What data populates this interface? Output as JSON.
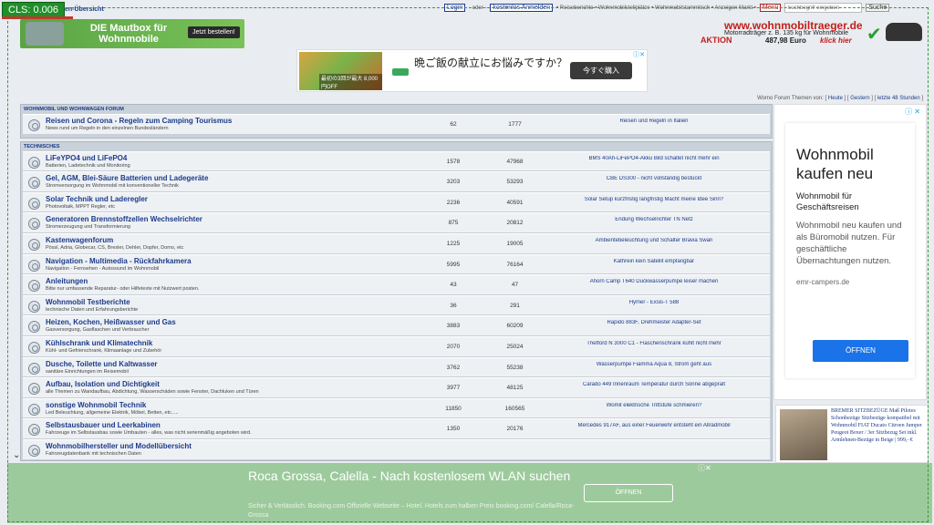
{
  "overlay": {
    "cls_label": "CLS: 0.006"
  },
  "topbar": {
    "forum_overview": "oren-Übersicht",
    "login": "Login",
    "oder": "- oder -",
    "register": "kostenlos Anmelden",
    "nav_links": "• Reiseberichte • Wohnmobilstellplätze • Wohnmobilstammtisch • Anzeigen Markt •",
    "menu": "Menü",
    "search_placeholder": "Suchbegriff eingeben",
    "search_button": "Suche"
  },
  "banner_left": {
    "title": "DIE Mautbox für Wohnmobile",
    "cta": "Jetzt bestellen!"
  },
  "banner_right": {
    "url": "www.wohnmobiltraeger.de",
    "sub": "Motorradträger z. B. 135 kg für Wohnmobile",
    "aktion": "AKTION",
    "price": "487,98 Euro",
    "klick": "klick hier"
  },
  "ad_center": {
    "headline": "晩ご飯の献立にお悩みですか？",
    "button": "今すぐ購入",
    "food_text": "最初の3回が最大 8,000円OFF"
  },
  "themes_line": {
    "prefix": "Womo Forum Themen von:",
    "heute": "Heute",
    "gestern": "Gestern",
    "letzte": "letzte 48 Stunden"
  },
  "sections": [
    {
      "title": "WOHNMOBIL UND WOHNWAGEN FORUM",
      "rows": [
        {
          "title": "Reisen und Corona - Regeln zum Camping Tourismus",
          "desc": "News rund um Regeln in den einzelnen Bundesländern",
          "topics": "62",
          "posts": "1777",
          "last": "Reisen und Regeln in Italien"
        }
      ]
    },
    {
      "title": "TECHNISCHES",
      "rows": [
        {
          "title": "LiFeYPO4 und LiFePO4",
          "desc": "Batterien, Ladetechnik und Monitoring",
          "topics": "1578",
          "posts": "47968",
          "last": "BMS 40Ah-LiFePO4-Akku Bild schaltet nicht mehr ein"
        },
        {
          "title": "Gel, AGM, Blei-Säure Batterien und Ladegeräte",
          "desc": "Stromversorgung im Wohnmobil mit konventioneller Technik",
          "topics": "3203",
          "posts": "53293",
          "last": "CBE DS300 - nicht vollständig bestückt"
        },
        {
          "title": "Solar Technik und Laderegler",
          "desc": "Photovoltaik, MPPT Regler, etc",
          "topics": "2236",
          "posts": "40591",
          "last": "Solar Setup kurzfristig langfristig Macht meine Idee Sinn?"
        },
        {
          "title": "Generatoren Brennstoffzellen Wechselrichter",
          "desc": "Stromerzeugung und Transformierung",
          "topics": "875",
          "posts": "20812",
          "last": "Endung Wechselrichter TN Netz"
        },
        {
          "title": "Kastenwagenforum",
          "desc": "Pössl, Adria, Globecar, CS, Bresler, Dehler, Dopfer, Domo, etc",
          "topics": "1225",
          "posts": "19005",
          "last": "Ambientebeleuchtung und Schalter Bravia Swan"
        },
        {
          "title": "Navigation - Multimedia - Rückfahrkamera",
          "desc": "Navigation - Fernsehen - Autosound im Wohnmobil",
          "topics": "5995",
          "posts": "76164",
          "last": "Kathrein kein Satellit empfangbar"
        },
        {
          "title": "Anleitungen",
          "desc": "Bitte nur umfassende Reparatur- oder Hilfetexte mit Nutzwert posten.",
          "topics": "43",
          "posts": "47",
          "last": "Ahorn Camp T640 Duckwasserpumpe leiser machen"
        },
        {
          "title": "Wohnmobil Testberichte",
          "desc": "technische Daten und Erfahrungsberichte",
          "topics": "36",
          "posts": "291",
          "last": "Hymer - Exsis-T 588"
        },
        {
          "title": "Heizen, Kochen, Heißwasser und Gas",
          "desc": "Gasversorgung, Gasflaschen und Verbraucher",
          "topics": "3883",
          "posts": "60209",
          "last": "Rapido 883F, Drehmeister Adapter-Set"
        },
        {
          "title": "Kühlschrank und Klimatechnik",
          "desc": "Kühl- und Gefrierschrank, Klimaanlage und Zubehör",
          "topics": "2070",
          "posts": "25024",
          "last": "Thetford N 3000 C1 - Flaschenschrank kühlt nicht mehr"
        },
        {
          "title": "Dusche, Toilette und Kaltwasser",
          "desc": "sanitäre Einrichtungen im Reisemobil",
          "topics": "3762",
          "posts": "55238",
          "last": "Wasserpumpe Fiamma Aqua 8, Strom geht aus"
        },
        {
          "title": "Aufbau, Isolation und Dichtigkeit",
          "desc": "alle Themen zu Wandaufbau, Abdichtung, Wasserschäden sowie Fenster, Dachluken und Türen",
          "topics": "3977",
          "posts": "48125",
          "last": "Carado 449 Innenraum Temperatur durch Sonne abgepralt"
        },
        {
          "title": "sonstige Wohnmobil Technik",
          "desc": "Led Beleuchtung, allgemeine Elektrik, Möbel, Betten, etc.....",
          "topics": "11850",
          "posts": "160565",
          "last": "Womit elektrische Trittstufe schmieren?"
        },
        {
          "title": "Selbstausbauer und Leerkabinen",
          "desc": "Fahrzeuge im Selbstausbau sowie Umbauten - alles, was nicht serienmäßig angeboten wird.",
          "topics": "1350",
          "posts": "20176",
          "last": "Mercedes 917AF, aus einer Feuerwehr entsteht ein Allradmobil"
        },
        {
          "title": "Wohnmobilhersteller und Modellübersicht",
          "desc": "Fahrzeugdatenbank mit technischen Daten",
          "topics": "",
          "posts": "",
          "last": ""
        }
      ]
    }
  ],
  "right_ad": {
    "headline": "Wohnmobil kaufen neu",
    "subhead": "Wohnmobil für Geschäftsreisen",
    "body": "Wohnmobil neu kaufen und als Büromobil nutzen. Für geschäftliche Übernachtungen nutzen.",
    "domain": "emr-campers.de",
    "button": "ÖFFNEN"
  },
  "right_small": {
    "text": "BREMER SITZBEZÜGE Maß Pilotes Schonbezüge Sitzbezüge kompatibel mit Wohnmobil FIAT Ducato Citroen Jumper Peugeot Boxer / 3er Sitzbezug Set inkl. Armlehnen-Bezüge in Beige | 999,- €"
  },
  "bottom_ad": {
    "title": "Roca Grossa, Calella - Nach kostenlosem WLAN suchen",
    "sub": "Sicher & Verlässlich. Booking.com Offizielle Webseite – Hotel. Hotels zum halben Preis booking.com/ Calella/Roca-Grossa",
    "button": "ÖFFNEN"
  }
}
